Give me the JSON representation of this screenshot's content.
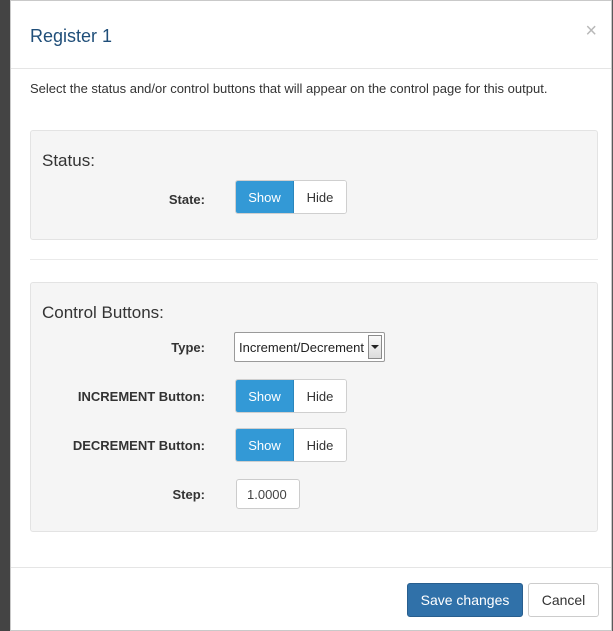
{
  "modal": {
    "title": "Register 1",
    "close_glyph": "×",
    "intro": "Select the status and/or control buttons that will appear on the control page for this output."
  },
  "status_panel": {
    "title": "Status:",
    "state": {
      "label": "State:",
      "show": "Show",
      "hide": "Hide",
      "selected": "Show"
    }
  },
  "control_panel": {
    "title": "Control Buttons:",
    "type": {
      "label": "Type:",
      "value": "Increment/Decrement"
    },
    "increment": {
      "label": "INCREMENT Button:",
      "show": "Show",
      "hide": "Hide",
      "selected": "Show"
    },
    "decrement": {
      "label": "DECREMENT Button:",
      "show": "Show",
      "hide": "Hide",
      "selected": "Show"
    },
    "step": {
      "label": "Step:",
      "value": "1.0000"
    }
  },
  "footer": {
    "save_label": "Save changes",
    "cancel_label": "Cancel"
  },
  "colors": {
    "title": "#1f4e79",
    "toggle_active": "#3399d6",
    "primary_button": "#3071a9"
  }
}
